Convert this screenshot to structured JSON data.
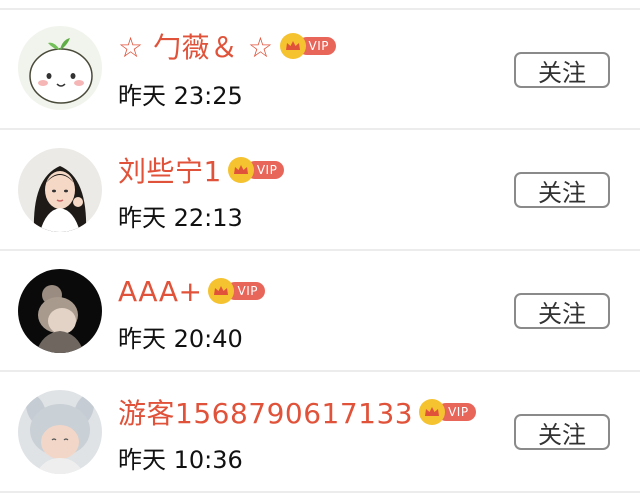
{
  "users": [
    {
      "name": "☆ 勹薇＆ ☆",
      "vip_label": "VIP",
      "time": "昨天 23:25",
      "follow_label": "关注"
    },
    {
      "name": "刘些宁1",
      "vip_label": "VIP",
      "time": "昨天 22:13",
      "follow_label": "关注"
    },
    {
      "name": "AAA+",
      "vip_label": "VIP",
      "time": "昨天 20:40",
      "follow_label": "关注"
    },
    {
      "name": "游客1568790617133",
      "vip_label": "VIP",
      "time": "昨天 10:36",
      "follow_label": "关注"
    }
  ],
  "colors": {
    "name": "#e0533a",
    "vip_pill": "#e8655a",
    "vip_crown": "#f5c230",
    "button_border": "#8a8a8a",
    "divider": "#ececec"
  }
}
